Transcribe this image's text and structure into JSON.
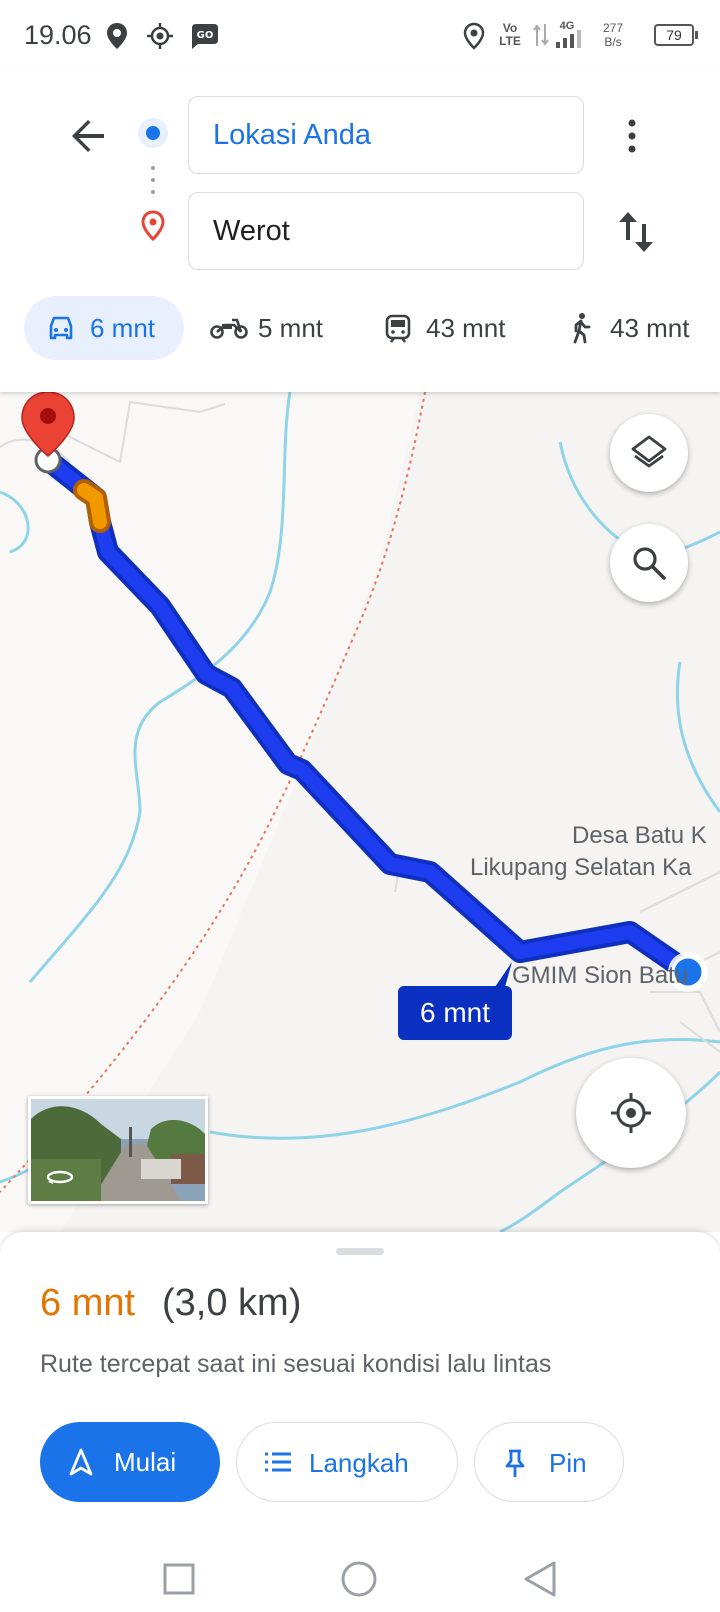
{
  "status_bar": {
    "time": "19.06",
    "network": "4G",
    "volte_top": "Vo",
    "volte_bottom": "LTE",
    "speed_value": "277",
    "speed_unit": "B/s",
    "battery": "79"
  },
  "directions": {
    "origin": "Lokasi Anda",
    "destination": "Werot",
    "modes": [
      {
        "icon": "car-icon",
        "label": "6 mnt",
        "active": true
      },
      {
        "icon": "motorcycle-icon",
        "label": "5 mnt",
        "active": false
      },
      {
        "icon": "train-icon",
        "label": "43 mnt",
        "active": false
      },
      {
        "icon": "walking-icon",
        "label": "43 mnt",
        "active": false
      }
    ]
  },
  "map": {
    "labels": {
      "desa": "Desa Batu K",
      "likupang": "Likupang Selatan Ka",
      "gmim": "GMIM Sion Batu"
    },
    "eta_badge": "6 mnt",
    "route_color": "#1e3cf0",
    "traffic_color": "#f29900"
  },
  "summary": {
    "time": "6 mnt",
    "distance": "(3,0 km)",
    "description": "Rute tercepat saat ini sesuai kondisi lalu lintas",
    "buttons": {
      "start": "Mulai",
      "steps": "Langkah",
      "pin": "Pin"
    }
  },
  "colors": {
    "accent": "#1a73e8",
    "eta_orange": "#e37400",
    "destination_red": "#ea4335"
  }
}
